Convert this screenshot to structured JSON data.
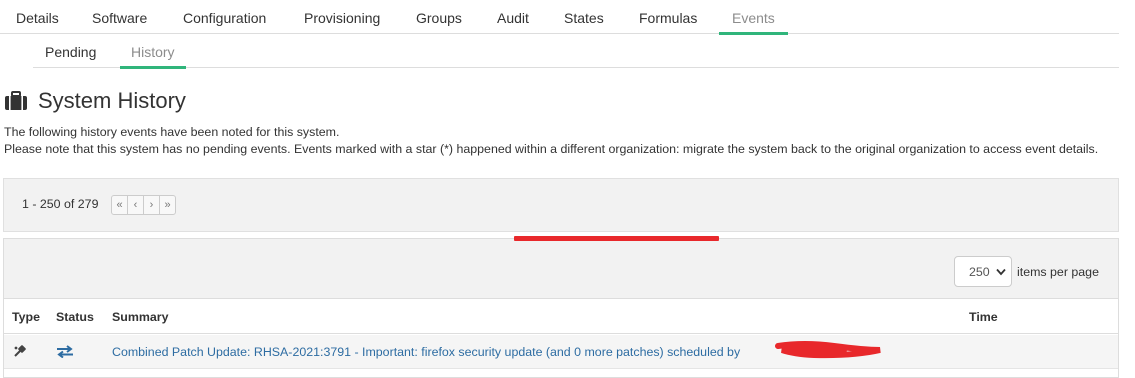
{
  "top_tabs": [
    {
      "label": "Details"
    },
    {
      "label": "Software"
    },
    {
      "label": "Configuration"
    },
    {
      "label": "Provisioning"
    },
    {
      "label": "Groups"
    },
    {
      "label": "Audit"
    },
    {
      "label": "States"
    },
    {
      "label": "Formulas"
    },
    {
      "label": "Events",
      "active": true
    }
  ],
  "sub_tabs": [
    {
      "label": "Pending"
    },
    {
      "label": "History",
      "active": true
    }
  ],
  "page": {
    "title": "System History",
    "icon": "briefcase-icon",
    "description_line1": "The following history events have been noted for this system.",
    "description_line2": "Please note that this system has no pending events. Events marked with a star (*) happened within a different organization: migrate the system back to the original organization to access event details."
  },
  "pagination": {
    "range": "1 - 250 of 279",
    "buttons": [
      "«",
      "‹",
      "›",
      "»"
    ]
  },
  "items_per_page": {
    "value": "250",
    "label": "items per page"
  },
  "table": {
    "columns": {
      "type": "Type",
      "status": "Status",
      "summary": "Summary",
      "time": "Time"
    },
    "rows": [
      {
        "type_icon": "patch-icon",
        "status_icon": "transfer-arrows-icon",
        "summary": "Combined Patch Update: RHSA-2021:3791 - Important: firefox security update (and 0 more patches) scheduled by ",
        "time": ""
      }
    ]
  },
  "colors": {
    "accent": "#30b57b",
    "link": "#2d6ca2",
    "redaction": "#e8282b"
  }
}
